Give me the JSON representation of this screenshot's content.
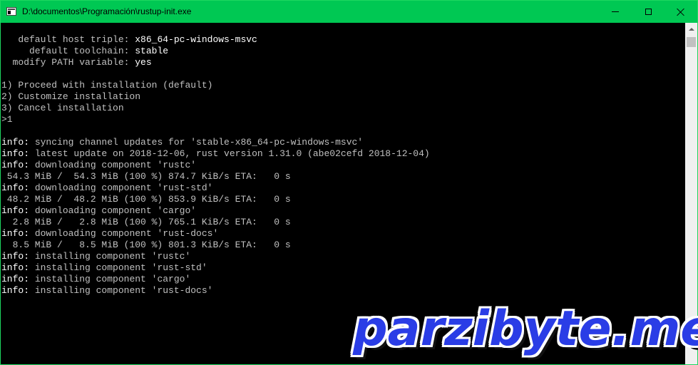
{
  "window": {
    "title": "D:\\documentos\\Programación\\rustup-init.exe",
    "controls": {
      "minimize_icon": "minimize-icon",
      "maximize_icon": "maximize-icon",
      "close_icon": "close-icon"
    }
  },
  "console": {
    "lines": [
      "   default host triple: x86_64-pc-windows-msvc",
      "     default toolchain: stable",
      "  modify PATH variable: yes",
      "",
      "1) Proceed with installation (default)",
      "2) Customize installation",
      "3) Cancel installation",
      ">1",
      "",
      "info: syncing channel updates for 'stable-x86_64-pc-windows-msvc'",
      "info: latest update on 2018-12-06, rust version 1.31.0 (abe02cefd 2018-12-04)",
      "info: downloading component 'rustc'",
      " 54.3 MiB /  54.3 MiB (100 %) 874.7 KiB/s ETA:   0 s",
      "info: downloading component 'rust-std'",
      " 48.2 MiB /  48.2 MiB (100 %) 853.9 KiB/s ETA:   0 s",
      "info: downloading component 'cargo'",
      "  2.8 MiB /   2.8 MiB (100 %) 765.1 KiB/s ETA:   0 s",
      "info: downloading component 'rust-docs'",
      "  8.5 MiB /   8.5 MiB (100 %) 801.3 KiB/s ETA:   0 s",
      "info: installing component 'rustc'",
      "info: installing component 'rust-std'",
      "info: installing component 'cargo'",
      "info: installing component 'rust-docs'"
    ]
  },
  "watermark": {
    "text": "parzibyte.me"
  },
  "colors": {
    "title_bar": "#00c853",
    "console_bg": "#000000",
    "console_text": "#c0c0c0",
    "highlight_text": "#ffffff",
    "watermark": "#2a3de6"
  }
}
